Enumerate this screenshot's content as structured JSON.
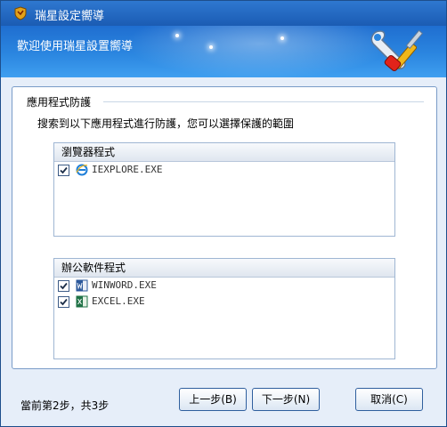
{
  "window": {
    "title": "瑞星設定嚮導"
  },
  "header": {
    "text": "歡迎使用瑞星設置嚮導"
  },
  "section": {
    "title": "應用程式防護",
    "description": "搜索到以下應用程式進行防護，您可以選擇保護的範圍"
  },
  "browser_group": {
    "title": "瀏覽器程式",
    "items": [
      {
        "label": "IEXPLORE.EXE",
        "checked": true,
        "icon": "ie-icon"
      }
    ]
  },
  "office_group": {
    "title": "辦公軟件程式",
    "items": [
      {
        "label": "WINWORD.EXE",
        "checked": true,
        "icon": "word-icon"
      },
      {
        "label": "EXCEL.EXE",
        "checked": true,
        "icon": "excel-icon"
      }
    ]
  },
  "footer": {
    "status": "當前第2步，共3步",
    "prev_label": "上一步(B)",
    "next_label": "下一步(N)",
    "cancel_label": "取消(C)"
  },
  "colors": {
    "titlebar": "#1b5cb3",
    "header": "#2b86e0",
    "panel_border": "#7a9cc8"
  }
}
